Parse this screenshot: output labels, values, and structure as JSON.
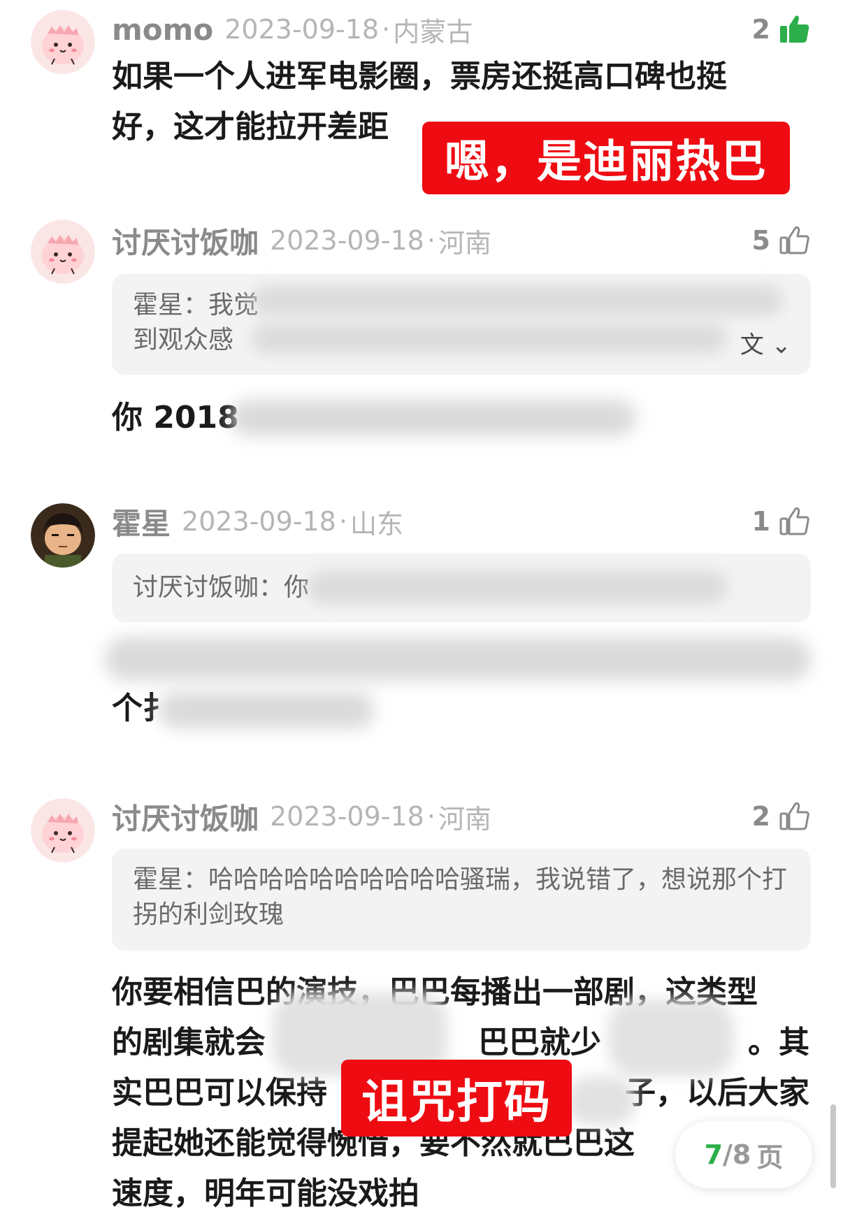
{
  "comments": [
    {
      "username": "momo",
      "date": "2023-09-18",
      "location": "内蒙古",
      "likes": "2",
      "liked": true,
      "body": "如果一个人进军电影圈，票房还挺高口碑也挺好，这才能拉开差距"
    },
    {
      "username": "讨厌讨饭咖",
      "date": "2023-09-18",
      "location": "河南",
      "likes": "5",
      "liked": false,
      "quote_author": "霍星：",
      "quote_line1": "我觉",
      "quote_line2": "到观众感",
      "quote_tail": "文",
      "body": "你 2018"
    },
    {
      "username": "霍星",
      "date": "2023-09-18",
      "location": "山东",
      "likes": "1",
      "liked": false,
      "quote_author": "讨厌讨饭咖：",
      "quote_line1": "你",
      "body": "个扌"
    },
    {
      "username": "讨厌讨饭咖",
      "date": "2023-09-18",
      "location": "河南",
      "likes": "2",
      "liked": false,
      "quote_author": "霍星：",
      "quote_text": "哈哈哈哈哈哈哈哈哈哈骚瑞，我说错了，想说那个打拐的利剑玫瑰",
      "body_lines": [
        "你要相信巴的演技，巴巴每播出一部剧，这类型",
        "的剧集就会",
        "实巴巴可以保持",
        "提起她还能觉得惋惜，要不然就巴巴这",
        "速度，明年可能没戏拍"
      ],
      "body_fragments": {
        "l2b": "巴巴就少",
        "l2c": "。其",
        "l3b": "子，以后大家"
      }
    }
  ],
  "stickers": {
    "top": "嗯，是迪丽热巴",
    "bottom": "诅咒打码"
  },
  "pagination": {
    "current": "7",
    "total": "/8",
    "unit": "页"
  },
  "colors": {
    "like_green": "#2cae4a",
    "sticker_red": "#ee0c12",
    "meta_gray": "#b5b5b5"
  },
  "icons": {
    "like": "thumbs-up-icon",
    "expand": "chevron-down-icon"
  }
}
